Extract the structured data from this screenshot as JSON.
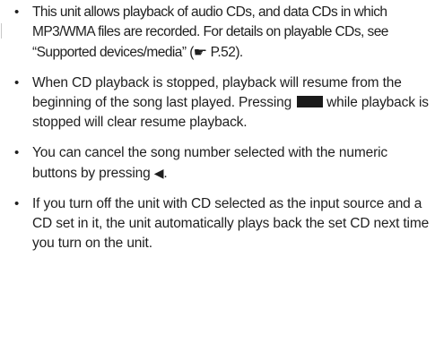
{
  "notes": [
    {
      "text_1": "This unit allows playback of audio CDs, and data CDs in which MP3/WMA files are recorded. For details on playable CDs, see “Supported devices/media” (",
      "icon": "reference-pointer-icon",
      "text_2": " P.52)."
    },
    {
      "text_1": "When CD playback is stopped, playback will resume from the beginning of the song last played. Pressing",
      "icon": "stop-square-icon",
      "text_2": "while playback is stopped will clear resume playback."
    },
    {
      "text_1": "You can cancel the song number selected with the numeric buttons by pressing ",
      "icon": "left-triangle-icon",
      "text_2": "."
    },
    {
      "text_1": "If you turn off the unit with CD selected as the input source and a CD set in it, the unit automatically plays back the set CD next time you turn on the unit."
    }
  ]
}
